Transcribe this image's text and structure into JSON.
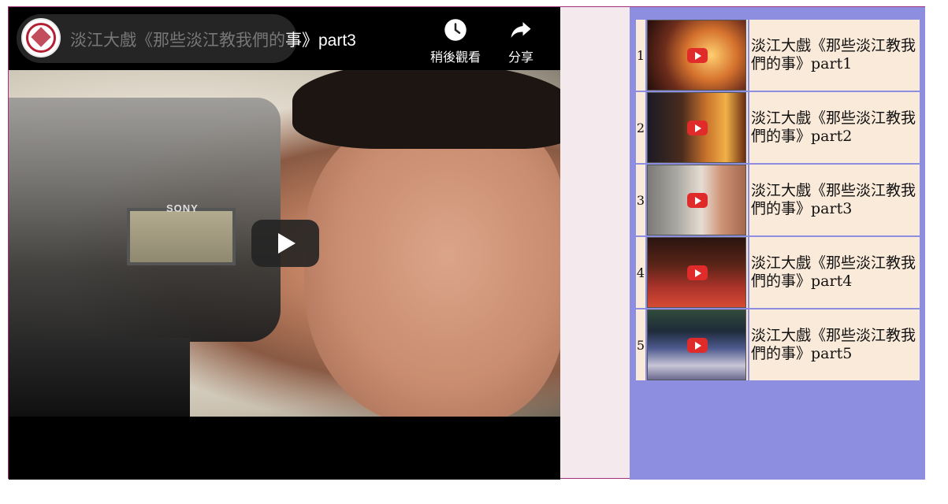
{
  "player": {
    "title_faded": "淡江大戲《那些淡江教我們的",
    "title_visible": "事》part3",
    "watch_later_label": "稍後觀看",
    "share_label": "分享",
    "channel_logo": "tamkang-university-logo",
    "camera_brand": "SONY"
  },
  "playlist": {
    "items": [
      {
        "index": "1",
        "title": "淡江大戲《那些淡江教我們的事》part1"
      },
      {
        "index": "2",
        "title": "淡江大戲《那些淡江教我們的事》part2"
      },
      {
        "index": "3",
        "title": "淡江大戲《那些淡江教我們的事》part3"
      },
      {
        "index": "4",
        "title": "淡江大戲《那些淡江教我們的事》part4"
      },
      {
        "index": "5",
        "title": "淡江大戲《那些淡江教我們的事》part5"
      }
    ]
  },
  "colors": {
    "sidebar": "#8e8ee0",
    "row_bg": "#faead9",
    "frame_border": "#a0307a",
    "page_bg": "#f4e9ec",
    "play_red": "#e02b2b"
  },
  "icons": [
    "clock-icon",
    "share-arrow-icon",
    "play-icon",
    "youtube-play-icon"
  ]
}
